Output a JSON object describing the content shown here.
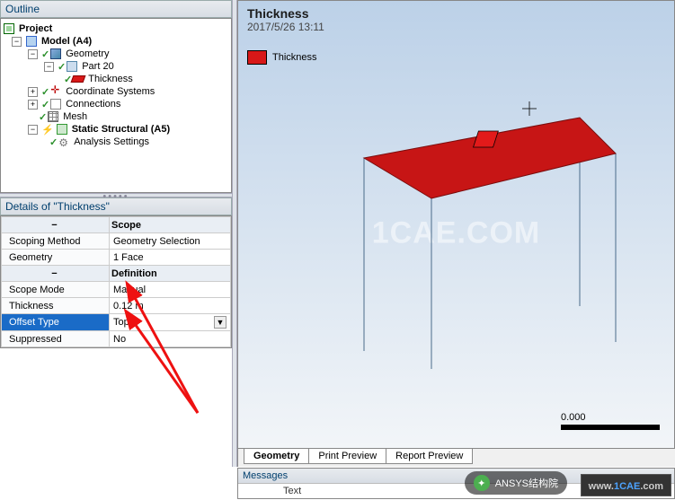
{
  "outline": {
    "title": "Outline",
    "project": "Project",
    "model": "Model (A4)",
    "geometry": "Geometry",
    "part": "Part 20",
    "thickness": "Thickness",
    "coord": "Coordinate Systems",
    "connections": "Connections",
    "mesh": "Mesh",
    "static": "Static Structural (A5)",
    "analysis": "Analysis Settings"
  },
  "details": {
    "title": "Details of \"Thickness\"",
    "scope": "Scope",
    "scoping_method_k": "Scoping Method",
    "scoping_method_v": "Geometry Selection",
    "geometry_k": "Geometry",
    "geometry_v": "1 Face",
    "definition": "Definition",
    "scope_mode_k": "Scope Mode",
    "scope_mode_v": "Manual",
    "thickness_k": "Thickness",
    "thickness_v": "0.12 m",
    "offset_k": "Offset Type",
    "offset_v": "Top",
    "suppressed_k": "Suppressed",
    "suppressed_v": "No"
  },
  "viewport": {
    "title": "Thickness",
    "timestamp": "2017/5/26 13:11",
    "legend": "Thickness",
    "watermark": "1CAE.COM",
    "scale_value": "0.000"
  },
  "tabs": {
    "geometry": "Geometry",
    "print": "Print Preview",
    "report": "Report Preview"
  },
  "messages": {
    "title": "Messages",
    "col_text": "Text"
  },
  "badges": {
    "wx": "ANSYS结构院",
    "url_a": "www.",
    "url_b": "1CAE",
    "url_c": ".com"
  }
}
